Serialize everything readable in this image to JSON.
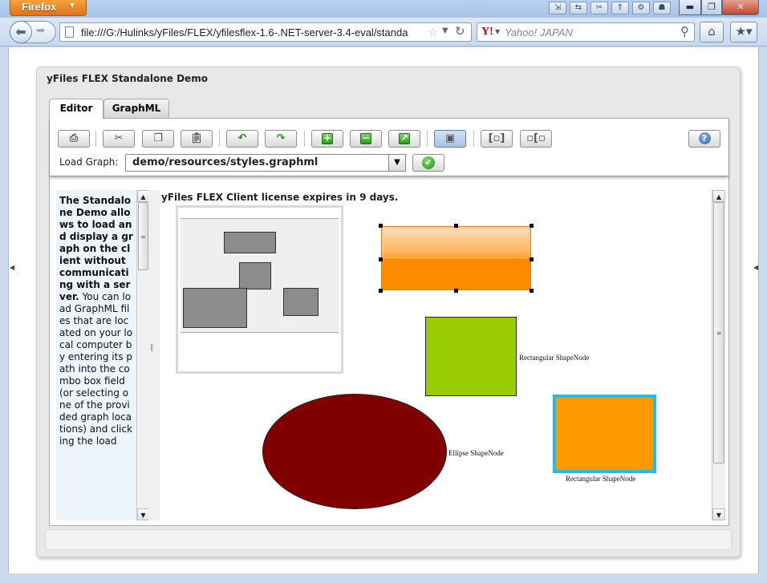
{
  "browser": {
    "menu_button": "Firefox",
    "url": "file:///G:/Hulinks/yFiles/FLEX/yfilesflex-1.6-.NET-server-3.4-eval/standa",
    "search_placeholder": "Yahoo! JAPAN",
    "search_engine_icon": "Y!"
  },
  "app": {
    "title": "yFiles FLEX Standalone Demo",
    "tabs": [
      {
        "label": "Editor",
        "selected": true
      },
      {
        "label": "GraphML",
        "selected": false
      }
    ],
    "load_graph": {
      "label": "Load Graph:",
      "value": "demo/resources/styles.graphml"
    },
    "description": {
      "bold": "The Standalone Demo allows to load and display a graph on the client without communicating with a server.",
      "normal": "You can load GraphML files that are located on your local computer by entering its path into the combo box field (or selecting one of the provided graph locations) and clicking the load"
    },
    "license_notice": "yFiles FLEX Client license expires in 9 days.",
    "node_labels": {
      "green": "Rectangular ShapeNode",
      "ellipse": "Ellipse ShapeNode",
      "orange": "Rectangular ShapeNode"
    },
    "colors": {
      "orange_gradient_node": "#ff8c00",
      "green_node": "#99cc00",
      "ellipse_node": "#800000",
      "orange_node": "#ff9900",
      "orange_node_border": "#1ebef0"
    }
  }
}
